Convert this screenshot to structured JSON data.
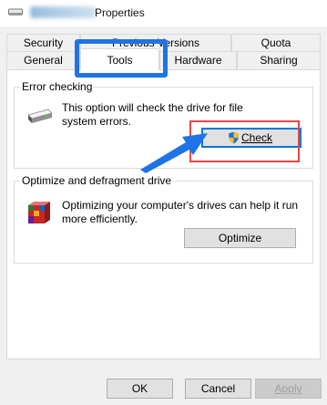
{
  "window": {
    "title": "Properties",
    "title_icon": "drive-icon"
  },
  "tabs_row1": [
    {
      "label": "Security"
    },
    {
      "label": "Previous Versions"
    },
    {
      "label": "Quota"
    }
  ],
  "tabs_row2": [
    {
      "label": "General"
    },
    {
      "label": "Tools",
      "active": true
    },
    {
      "label": "Hardware"
    },
    {
      "label": "Sharing"
    }
  ],
  "error_checking": {
    "title": "Error checking",
    "description": "This option will check the drive for file system errors.",
    "line1": "This option will check the drive for file",
    "line2": "system errors.",
    "icon": "drive-icon",
    "button": {
      "label": "Check",
      "icon": "shield-icon"
    }
  },
  "optimize": {
    "title": "Optimize and defragment drive",
    "line1": "Optimizing your computer's drives can help it run",
    "line2": "more efficiently.",
    "icon": "defrag-icon",
    "button": {
      "label": "Optimize"
    }
  },
  "footer": {
    "ok": "OK",
    "cancel": "Cancel",
    "apply": "Apply"
  },
  "annotations": {
    "highlight_color": "#1e73e6",
    "check_highlight_color": "#e64646"
  }
}
